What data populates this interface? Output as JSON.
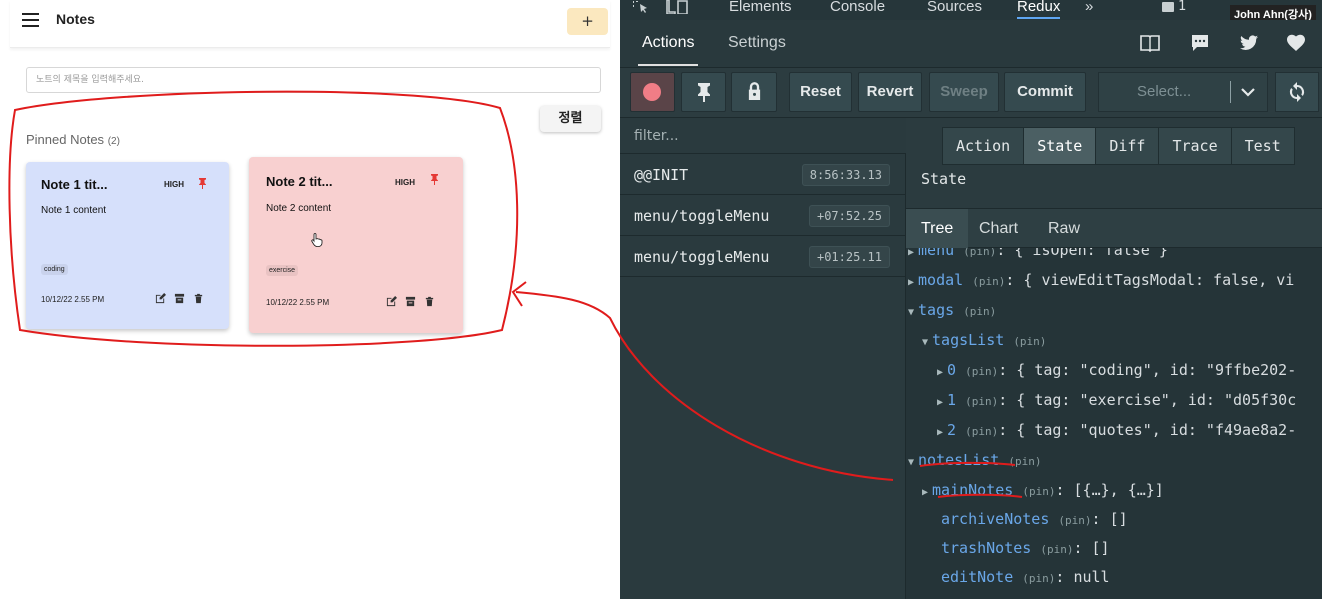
{
  "app": {
    "title": "Notes",
    "add_button": "+",
    "search_placeholder": "노트의 제목을 입력해주세요.",
    "sort_button": "정렬",
    "pinned_heading": "Pinned Notes",
    "pinned_count": "(2)",
    "notes": [
      {
        "title": "Note 1 tit...",
        "priority": "HIGH",
        "content": "Note 1 content",
        "tag": "coding",
        "date": "10/12/22 2.55 PM",
        "color": "#d6e0fb"
      },
      {
        "title": "Note 2 tit...",
        "priority": "HIGH",
        "content": "Note 2 content",
        "tag": "exercise",
        "date": "10/12/22 2.55 PM",
        "color": "#f8d0d0"
      }
    ]
  },
  "devtools": {
    "top_tabs": [
      "Elements",
      "Console",
      "Sources",
      "Redux"
    ],
    "active_top_tab": "Redux",
    "more_tabs": "»",
    "issues_count": "1",
    "user_badge": "John Ahn(강사)",
    "sub_tabs": [
      "Actions",
      "Settings"
    ],
    "toolbar": {
      "reset": "Reset",
      "revert": "Revert",
      "sweep": "Sweep",
      "commit": "Commit",
      "select_placeholder": "Select..."
    },
    "filter_placeholder": "filter...",
    "actions": [
      {
        "name": "@@INIT",
        "time": "8:56:33.13"
      },
      {
        "name": "menu/toggleMenu",
        "time": "+07:52.25"
      },
      {
        "name": "menu/toggleMenu",
        "time": "+01:25.11"
      }
    ],
    "detail_tabs": [
      "Action",
      "State",
      "Diff",
      "Trace",
      "Test"
    ],
    "active_detail_tab": "State",
    "state_label": "State",
    "view_tabs": [
      "Tree",
      "Chart",
      "Raw"
    ],
    "tree": {
      "menu": {
        "key": "menu",
        "pin": "(pin)",
        "value": ": { isOpen: false }"
      },
      "modal": {
        "key": "modal",
        "pin": "(pin)",
        "value": ": { viewEditTagsModal: false, vi"
      },
      "tags": {
        "key": "tags",
        "pin": "(pin)"
      },
      "tagsList": {
        "key": "tagsList",
        "pin": "(pin)"
      },
      "tag0": {
        "key": "0",
        "pin": "(pin)",
        "value": ": { tag: \"coding\", id: \"9ffbe202-"
      },
      "tag1": {
        "key": "1",
        "pin": "(pin)",
        "value": ": { tag: \"exercise\", id: \"d05f30c"
      },
      "tag2": {
        "key": "2",
        "pin": "(pin)",
        "value": ": { tag: \"quotes\", id: \"f49ae8a2-"
      },
      "notesList": {
        "key": "notesList",
        "pin": "(pin)"
      },
      "mainNotes": {
        "key": "mainNotes",
        "pin": "(pin)",
        "value": ": [{…}, {…}]"
      },
      "archiveNotes": {
        "key": "archiveNotes",
        "pin": "(pin)",
        "value": ": []"
      },
      "trashNotes": {
        "key": "trashNotes",
        "pin": "(pin)",
        "value": ": []"
      },
      "editNote": {
        "key": "editNote",
        "pin": "(pin)",
        "value": ": null"
      }
    }
  }
}
